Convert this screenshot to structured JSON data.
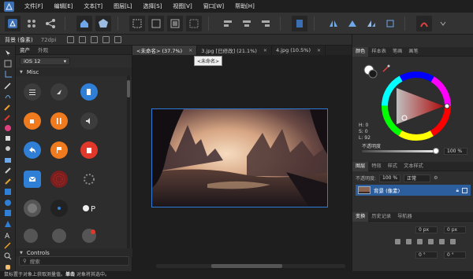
{
  "menu": {
    "items": [
      "文件[F]",
      "编辑[E]",
      "文本[T]",
      "图层[L]",
      "选择[S]",
      "视图[V]",
      "窗口[W]",
      "帮助[H]"
    ]
  },
  "context_bar": {
    "layer_label": "背景 (像素)",
    "dpi": "72dpi"
  },
  "assets_panel": {
    "tabs": [
      "资产",
      "外观"
    ],
    "platform_select": "iOS 12",
    "section_misc": "Misc",
    "section_controls": "Controls",
    "search_placeholder": "搜索",
    "accent_color": "#2f7fd6",
    "orange_color": "#f07b1e",
    "red_color": "#e0382a",
    "icons": [
      {
        "name": "list-icon",
        "bg": "#3c3c3c"
      },
      {
        "name": "location-arrow-icon",
        "bg": "#3c3c3c"
      },
      {
        "name": "fuel-icon",
        "bg": "#2f7fd6"
      },
      {
        "name": "coffee-icon",
        "bg": "#f07b1e"
      },
      {
        "name": "cutlery-icon",
        "bg": "#f07b1e"
      },
      {
        "name": "volume-icon",
        "bg": "#3c3c3c"
      },
      {
        "name": "reply-arrow-icon",
        "bg": "#2f7fd6"
      },
      {
        "name": "flag-icon",
        "bg": "#f07b1e"
      },
      {
        "name": "trash-icon",
        "bg": "#e0382a"
      },
      {
        "name": "mail-icon",
        "bg": "#2f7fd6"
      },
      {
        "name": "pattern-icon",
        "bg": "#7a1e1e"
      },
      {
        "name": "spinner-icon",
        "bg": "transparent"
      },
      {
        "name": "avatar-placeholder-icon",
        "bg": "#555555"
      },
      {
        "name": "record-icon",
        "bg": "#222222"
      },
      {
        "name": "apple-pay-icon",
        "bg": "transparent"
      },
      {
        "name": "profile-small-icon",
        "bg": "#555555"
      },
      {
        "name": "profile-small-icon",
        "bg": "#555555"
      },
      {
        "name": "profile-badge-icon",
        "bg": "#555555"
      }
    ]
  },
  "doc_tabs": [
    {
      "label": "<未命名> (37.7%)",
      "active": true
    },
    {
      "label": "3.jpg [已修改] (21.1%)",
      "active": false
    },
    {
      "label": "4.jpg (10.5%)",
      "active": false
    }
  ],
  "tooltip": "<未命名>",
  "right_panel": {
    "color_tabs": [
      "颜色",
      "样本表",
      "笔画",
      "画笔"
    ],
    "hsl": {
      "h": "H: 0",
      "s": "S: 0",
      "l": "L: 92"
    },
    "opacity_label": "不透明度",
    "opacity_value": "100 %",
    "layer_tabs": [
      "图层",
      "特效",
      "样式",
      "文本样式"
    ],
    "layer_opacity": "100 %",
    "blend_mode": "正常",
    "layer_name": "背景 (像素)",
    "history_tabs": [
      "变换",
      "历史记录",
      "导航器"
    ],
    "transform_fields": [
      "0 px",
      "0 px",
      "0 °",
      "0 °"
    ]
  },
  "status_bar": {
    "prefix": "鼠标置于对象上获取测量值。",
    "bold": "单击",
    "suffix": " 对象将其选中。"
  }
}
